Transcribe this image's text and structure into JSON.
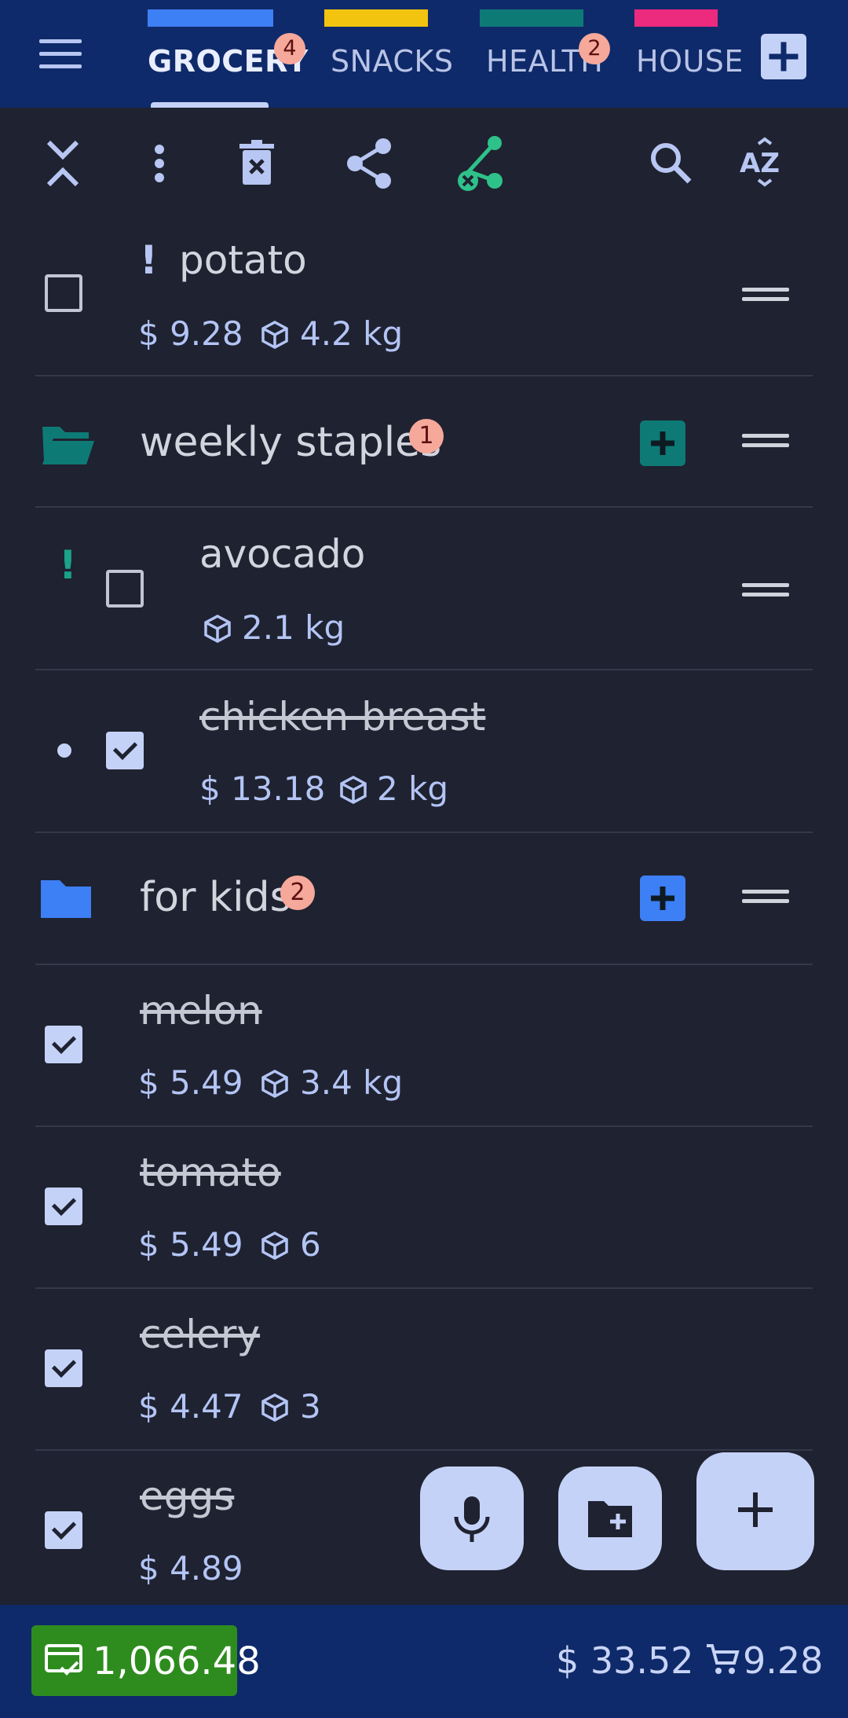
{
  "tabs": [
    {
      "label": "GROCERY",
      "color": "#3d7ff5",
      "badge": "4",
      "active": true
    },
    {
      "label": "SNACKS",
      "color": "#f2c40f",
      "badge": "",
      "active": false
    },
    {
      "label": "HEALTH",
      "color": "#0e7a76",
      "badge": "2",
      "active": false
    },
    {
      "label": "HOUSE",
      "color": "#ec2a7e",
      "badge": "",
      "active": false
    }
  ],
  "toolbar_icons": [
    "collapse-all-icon",
    "more-vert-icon",
    "delete-icon",
    "share-icon",
    "unshare-icon",
    "search-icon",
    "sort-az-icon"
  ],
  "items": {
    "potato": {
      "name": "potato",
      "price": "$ 9.28",
      "qty": "4.2 kg",
      "priority": "!"
    },
    "group1": {
      "name": "weekly staples",
      "badge": "1",
      "color": "#0e7a76"
    },
    "avocado": {
      "name": "avocado",
      "qty": "2.1 kg",
      "priority": "!"
    },
    "chicken": {
      "name": "chicken breast",
      "price": "$ 13.18",
      "qty": "2 kg"
    },
    "group2": {
      "name": "for kids",
      "badge": "2",
      "color": "#3d7ff5"
    },
    "melon": {
      "name": "melon",
      "price": "$ 5.49",
      "qty": "3.4 kg"
    },
    "tomato": {
      "name": "tomato",
      "price": "$ 5.49",
      "qty": "6"
    },
    "celery": {
      "name": "celery",
      "price": "$ 4.47",
      "qty": "3"
    },
    "eggs": {
      "name": "eggs",
      "price": "$ 4.89"
    }
  },
  "fabs": [
    "mic-icon",
    "new-folder-icon",
    "add-icon"
  ],
  "bottom": {
    "budget": "1,066.48",
    "total": "$ 33.52",
    "cart": "9.28"
  }
}
